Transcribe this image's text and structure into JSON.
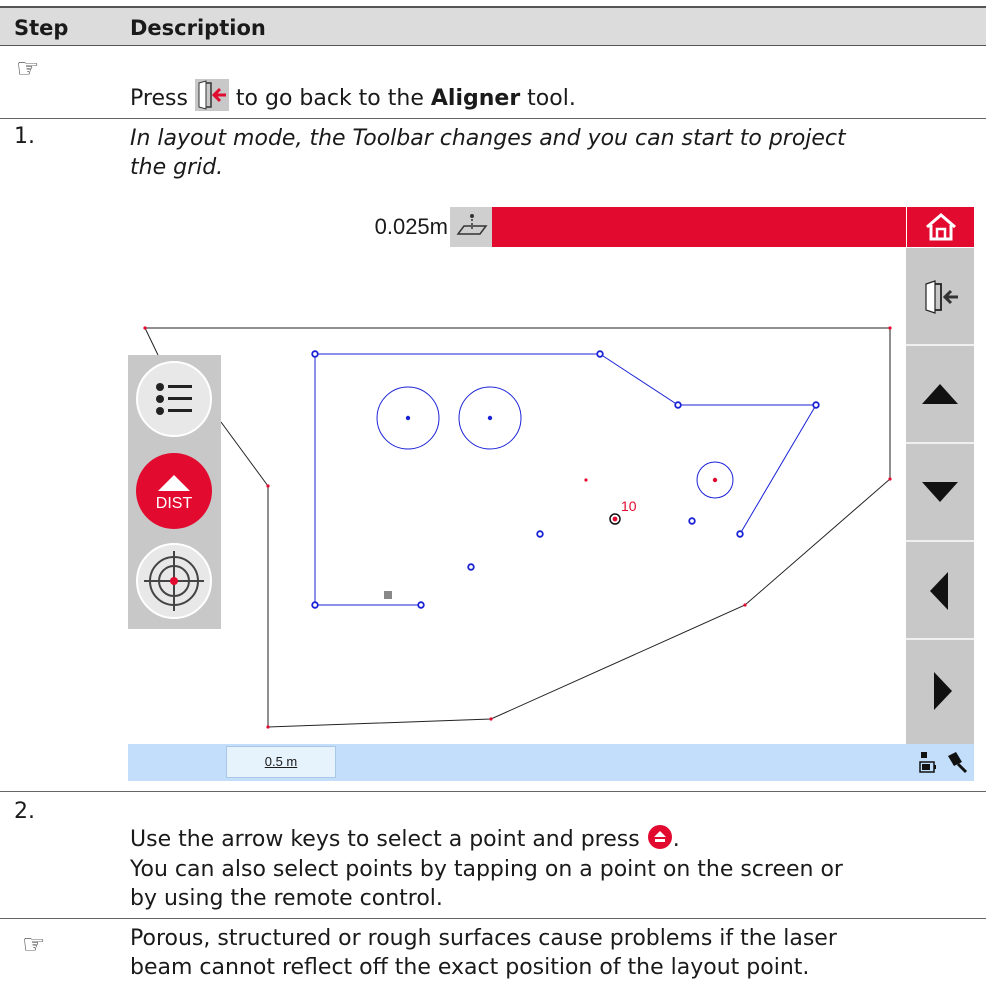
{
  "table_header": {
    "step": "Step",
    "description": "Description"
  },
  "rows": {
    "note1": {
      "symbol": "☞",
      "before": "Press",
      "after": "to go back to the",
      "bold": "Aligner",
      "end": "tool."
    },
    "step1": {
      "number": "1.",
      "line1": "In layout mode, the Toolbar changes and you can start to project",
      "line2": "the grid."
    },
    "step2": {
      "number": "2.",
      "line1a": "Use the arrow keys to select a point and press",
      "line1b": ".",
      "line2": "You can also select points by tapping on a point on the screen or",
      "line3": "by using the remote control."
    },
    "note2": {
      "symbol": "☞",
      "line1": "Porous, structured or rough surfaces cause problems if the laser",
      "line2": "beam cannot reflect off the exact position of the layout point."
    }
  },
  "screen": {
    "distance_value": "0.025m",
    "dist_button_label": "DIST",
    "point_label": "10",
    "scale_label": "0.5 m",
    "icons": [
      "home-icon",
      "exit-icon",
      "arrow-up-icon",
      "arrow-down-icon",
      "arrow-left-icon",
      "arrow-right-icon",
      "list-icon",
      "dist-icon",
      "target-icon",
      "plane-icon",
      "battery-icon",
      "laser-icon"
    ],
    "colors": {
      "accent_red": "#e20a2f",
      "layout_blue": "#1a22d6",
      "status_blue": "#c2defa"
    }
  }
}
